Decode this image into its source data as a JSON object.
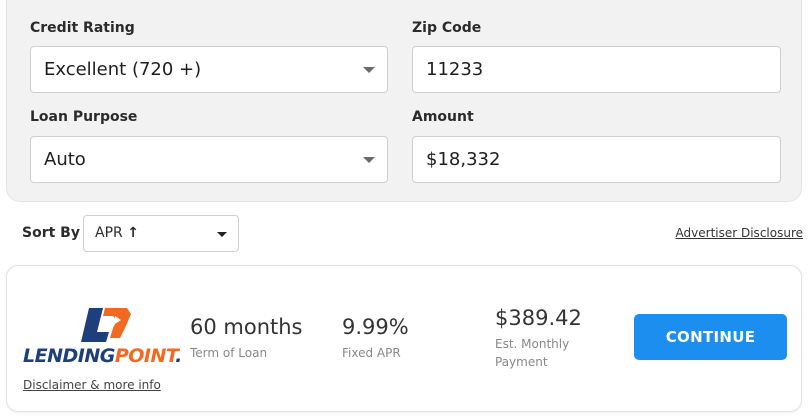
{
  "filters": {
    "credit_rating": {
      "label": "Credit Rating",
      "value": "Excellent (720 +)"
    },
    "zip_code": {
      "label": "Zip Code",
      "value": "11233"
    },
    "loan_purpose": {
      "label": "Loan Purpose",
      "value": "Auto"
    },
    "amount": {
      "label": "Amount",
      "value": "$18,332"
    }
  },
  "sort": {
    "label": "Sort By",
    "value": "APR",
    "direction_icon": "arrow-up-icon",
    "direction_glyph": "↑"
  },
  "advertiser_disclosure": "Advertiser Disclosure",
  "offer": {
    "lender": {
      "name_left": "LENDING",
      "name_right": "POINT",
      "name_suffix": ".",
      "logo_icon": "lendingpoint-logo",
      "colors": {
        "navy": "#1f3f7a",
        "orange": "#f26a21"
      }
    },
    "term": {
      "value": "60 months",
      "label": "Term of Loan"
    },
    "apr": {
      "value": "9.99%",
      "label": "Fixed APR"
    },
    "payment": {
      "value": "$389.42",
      "label_line1": "Est. Monthly",
      "label_line2": "Payment"
    },
    "cta_label": "CONTINUE",
    "disclaimer": "Disclaimer & more info"
  },
  "colors": {
    "accent": "#1b8ef0",
    "panel_bg": "#f2f2f2"
  }
}
